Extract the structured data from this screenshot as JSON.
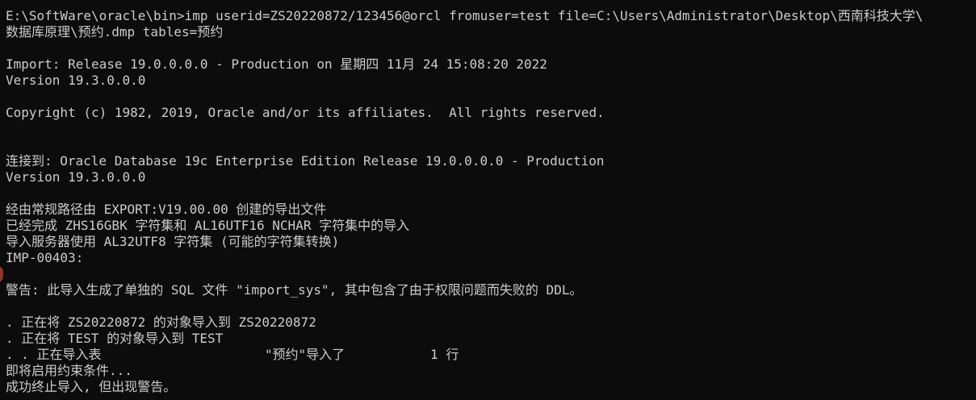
{
  "terminal": {
    "lines": [
      "E:\\SoftWare\\oracle\\bin>imp userid=ZS20220872/123456@orcl fromuser=test file=C:\\Users\\Administrator\\Desktop\\西南科技大学\\",
      "数据库原理\\预约.dmp tables=预约",
      "",
      "Import: Release 19.0.0.0.0 - Production on 星期四 11月 24 15:08:20 2022",
      "Version 19.3.0.0.0",
      "",
      "Copyright (c) 1982, 2019, Oracle and/or its affiliates.  All rights reserved.",
      "",
      "",
      "连接到: Oracle Database 19c Enterprise Edition Release 19.0.0.0.0 - Production",
      "Version 19.3.0.0.0",
      "",
      "经由常规路径由 EXPORT:V19.00.00 创建的导出文件",
      "已经完成 ZHS16GBK 字符集和 AL16UTF16 NCHAR 字符集中的导入",
      "导入服务器使用 AL32UTF8 字符集 (可能的字符集转换)",
      "IMP-00403:",
      "",
      "警告: 此导入生成了单独的 SQL 文件 \"import_sys\", 其中包含了由于权限问题而失败的 DDL。",
      "",
      ". 正在将 ZS20220872 的对象导入到 ZS20220872",
      ". 正在将 TEST 的对象导入到 TEST",
      ". . 正在导入表                     \"预约\"导入了           1 行",
      "即将启用约束条件...",
      "成功终止导入, 但出现警告。"
    ]
  }
}
